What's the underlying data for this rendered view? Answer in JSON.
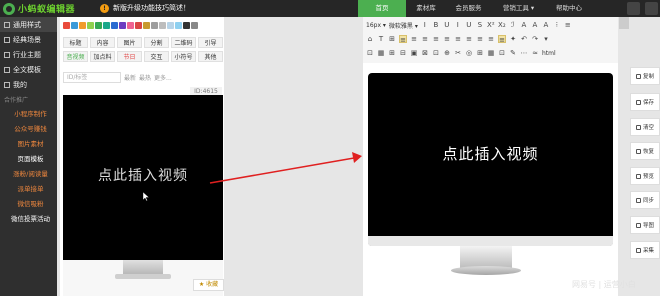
{
  "app": {
    "logo": "小蚂蚁编辑器",
    "notice": "新版升级功能技巧简述！"
  },
  "nav": [
    "首页",
    "素材库",
    "会员服务",
    "营销工具 ▾",
    "帮助中心"
  ],
  "sidebar": {
    "items": [
      {
        "label": "通用样式",
        "icon": "grid-icon"
      },
      {
        "label": "经典场景",
        "icon": "grid-icon"
      },
      {
        "label": "行业主题",
        "icon": "grid-icon"
      },
      {
        "label": "全文模板",
        "icon": "document-icon"
      },
      {
        "label": "我的",
        "icon": "user-icon"
      }
    ],
    "partner": "合作推广",
    "subitems": [
      {
        "label": "小程序制作",
        "color": "orange"
      },
      {
        "label": "公众号赚钱",
        "color": "orange"
      },
      {
        "label": "图片素材",
        "color": "orange"
      },
      {
        "label": "页面模板",
        "color": "white"
      },
      {
        "label": "涨粉/阅读量",
        "color": "orange"
      },
      {
        "label": "派单接单",
        "color": "orange"
      },
      {
        "label": "微信吸粉",
        "color": "orange"
      },
      {
        "label": "微信投票活动",
        "color": "white"
      }
    ]
  },
  "panel": {
    "colors": [
      "#e94b3c",
      "#3a9ad9",
      "#f29c2b",
      "#8fd14f",
      "#34a853",
      "#1aa88a",
      "#2a6bd1",
      "#6e3bc1",
      "#f06292",
      "#d94545",
      "#c89a2e",
      "#9e9e9e",
      "#bdbdbd",
      "#b8d4e8",
      "#8ed0f0",
      "#333333"
    ],
    "tags": [
      [
        "标题",
        "内容",
        "图片",
        "分割",
        "二维码",
        "引导"
      ],
      [
        "音视频",
        "加点料",
        "节日",
        "交互",
        "小符号",
        "其他"
      ]
    ],
    "search_placeholder": "ID/标签",
    "search_options": [
      "最新",
      "最热",
      "更多..."
    ],
    "item_id": "ID:4615",
    "card_text": "点此插入视频",
    "fav_label": "★ 收藏"
  },
  "toolbar": {
    "font_size": "16px ▾",
    "font_family": "微软雅黑 ▾",
    "row1": [
      "I",
      "B",
      "U",
      "I",
      "U",
      "S",
      "X²",
      "X₂",
      "ℐ",
      "A",
      "A",
      "A",
      "⁝",
      "≡"
    ],
    "row2": [
      "⌂",
      "T",
      "⊞",
      "≡",
      "≡",
      "≡",
      "≡",
      "≡",
      "≡",
      "≡",
      "≡",
      "≡",
      "≡",
      "✦",
      "↶",
      "↷",
      "▾"
    ],
    "row3": [
      "⊡",
      "▦",
      "⊞",
      "⊟",
      "▣",
      "⊠",
      "⊡",
      "⊕",
      "✂",
      "◎",
      "⊞",
      "▦",
      "⊡",
      "✎",
      "⋯",
      "≈",
      "html"
    ]
  },
  "editor": {
    "text": "点此插入视频"
  },
  "rightbar": [
    "复制",
    "保存",
    "清空",
    "恢复",
    "预览",
    "同步",
    "导图",
    "采集"
  ],
  "watermark": "网易号 | 运营小白"
}
